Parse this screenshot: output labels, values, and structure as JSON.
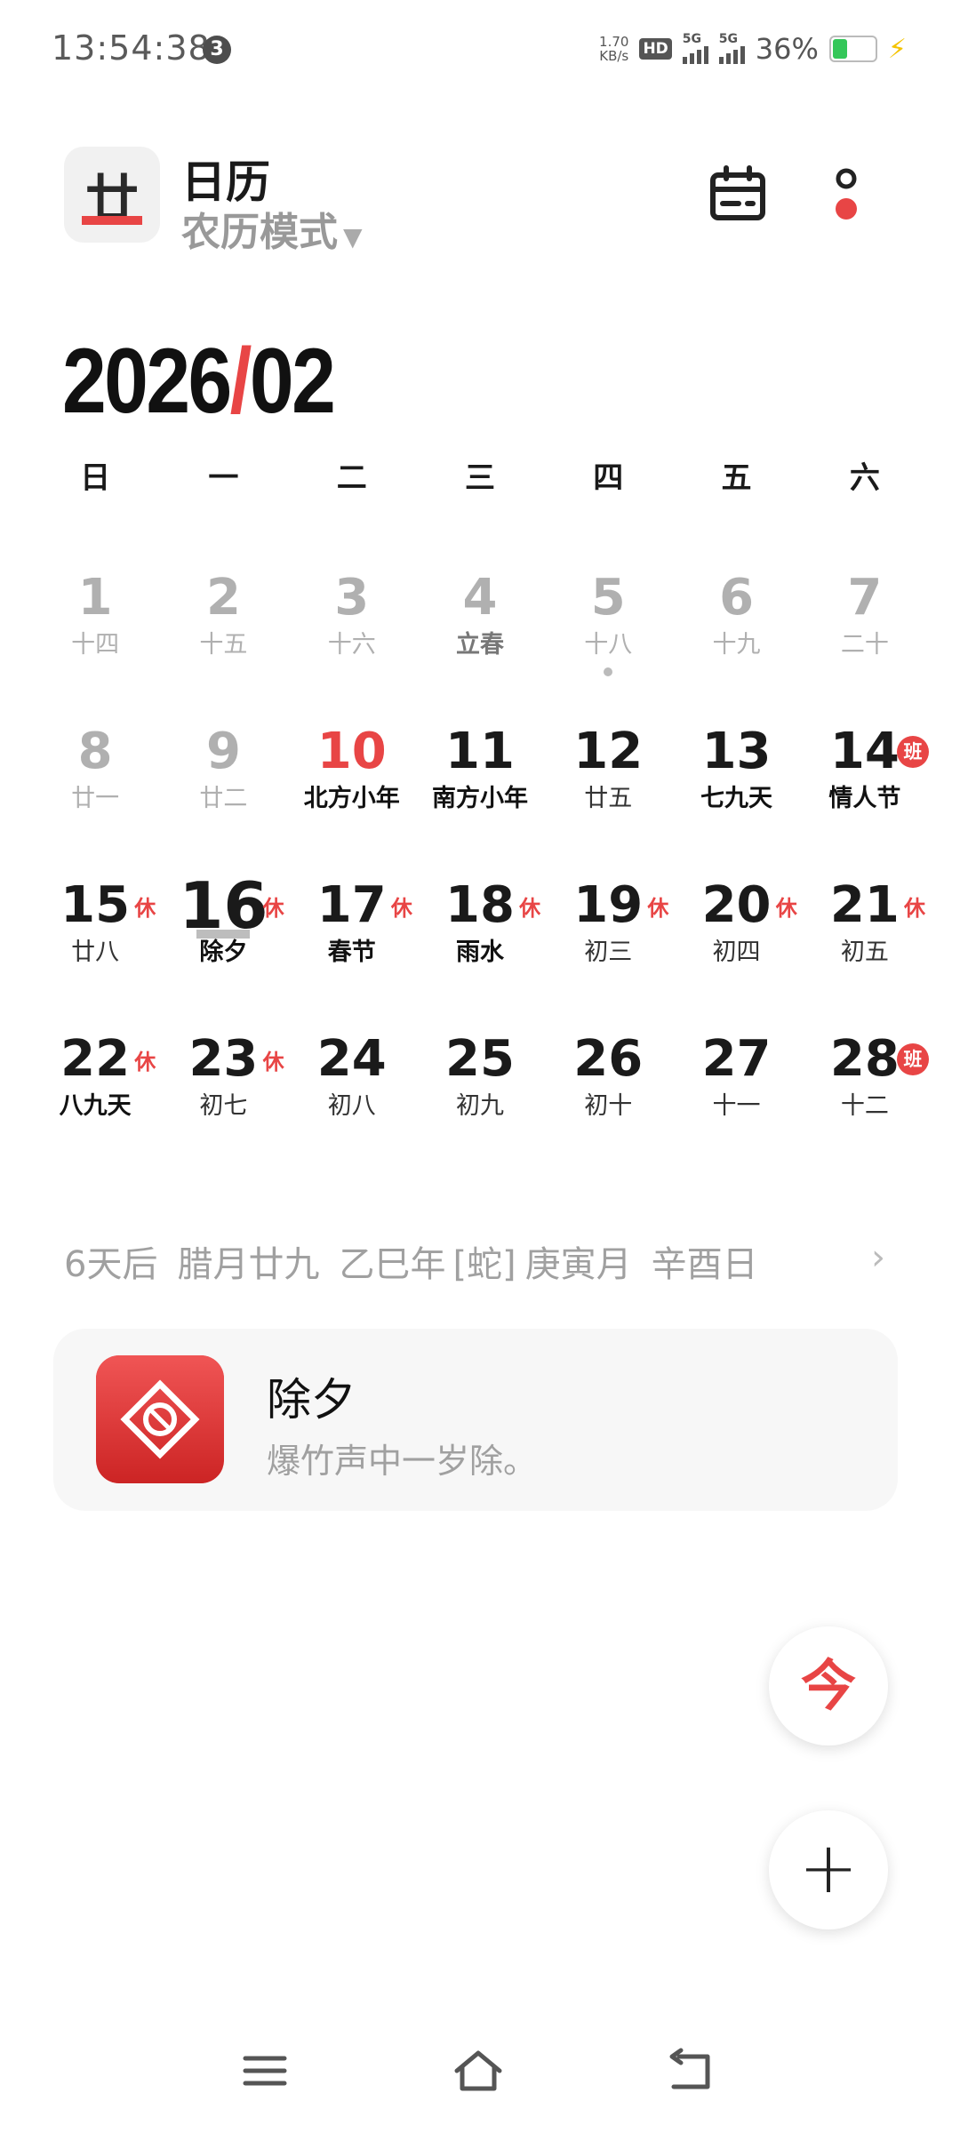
{
  "status_bar": {
    "time": "13:54:38",
    "notification_count": "3",
    "net_speed_value": "1.70",
    "net_speed_unit": "KB/s",
    "hd_label": "HD",
    "sim1_label": "5G",
    "sim2_label": "5G",
    "battery_percent": "36%",
    "battery_level": 0.36
  },
  "header": {
    "app_icon_glyph": "廿",
    "title": "日历",
    "mode": "农历模式"
  },
  "month_title": {
    "year": "2026",
    "separator": "/",
    "month": "02"
  },
  "weekdays": [
    "日",
    "一",
    "二",
    "三",
    "四",
    "五",
    "六"
  ],
  "days": [
    {
      "num": "1",
      "sub": "十四"
    },
    {
      "num": "2",
      "sub": "十五"
    },
    {
      "num": "3",
      "sub": "十六"
    },
    {
      "num": "4",
      "sub": "立春"
    },
    {
      "num": "5",
      "sub": "十八"
    },
    {
      "num": "6",
      "sub": "十九"
    },
    {
      "num": "7",
      "sub": "二十"
    },
    {
      "num": "8",
      "sub": "廿一"
    },
    {
      "num": "9",
      "sub": "廿二"
    },
    {
      "num": "10",
      "sub": "北方小年"
    },
    {
      "num": "11",
      "sub": "南方小年"
    },
    {
      "num": "12",
      "sub": "廿五"
    },
    {
      "num": "13",
      "sub": "七九天"
    },
    {
      "num": "14",
      "sub": "情人节",
      "tag": "班"
    },
    {
      "num": "15",
      "sub": "廿八",
      "tag": "休"
    },
    {
      "num": "16",
      "sub": "除夕",
      "tag": "休"
    },
    {
      "num": "17",
      "sub": "春节",
      "tag": "休"
    },
    {
      "num": "18",
      "sub": "雨水",
      "tag": "休"
    },
    {
      "num": "19",
      "sub": "初三",
      "tag": "休"
    },
    {
      "num": "20",
      "sub": "初四",
      "tag": "休"
    },
    {
      "num": "21",
      "sub": "初五",
      "tag": "休"
    },
    {
      "num": "22",
      "sub": "八九天",
      "tag": "休"
    },
    {
      "num": "23",
      "sub": "初七",
      "tag": "休"
    },
    {
      "num": "24",
      "sub": "初八"
    },
    {
      "num": "25",
      "sub": "初九"
    },
    {
      "num": "26",
      "sub": "初十"
    },
    {
      "num": "27",
      "sub": "十一"
    },
    {
      "num": "28",
      "sub": "十二",
      "tag": "班"
    }
  ],
  "lunar_info": {
    "countdown": "6天后",
    "lunar_date": "腊月廿九",
    "year_ganzhi": "乙巳年",
    "zodiac": "[蛇]",
    "month_ganzhi": "庚寅月",
    "day_ganzhi": "辛酉日"
  },
  "event": {
    "title": "除夕",
    "subtitle": "爆竹声中一岁除。"
  },
  "fab": {
    "today_label": "今",
    "add_label": "+"
  },
  "colors": {
    "accent": "#e84545",
    "muted": "#a0a0a0"
  }
}
